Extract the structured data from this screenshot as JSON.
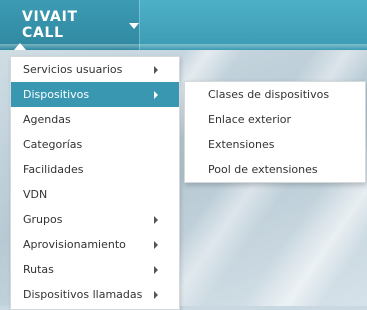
{
  "header": {
    "brand_label": "VIVAIT CALL",
    "brand_caret_icon": "caret-down-icon",
    "accent_color": "#3997b1"
  },
  "menu": {
    "items": [
      {
        "label": "Servicios usuarios",
        "has_submenu": true
      },
      {
        "label": "Dispositivos",
        "has_submenu": true,
        "active": true
      },
      {
        "label": "Agendas",
        "has_submenu": false
      },
      {
        "label": "Categorías",
        "has_submenu": false
      },
      {
        "label": "Facilidades",
        "has_submenu": false
      },
      {
        "label": "VDN",
        "has_submenu": false
      },
      {
        "label": "Grupos",
        "has_submenu": true
      },
      {
        "label": "Aprovisionamiento",
        "has_submenu": true
      },
      {
        "label": "Rutas",
        "has_submenu": true
      },
      {
        "label": "Dispositivos llamadas",
        "has_submenu": true
      }
    ]
  },
  "submenu": {
    "items": [
      {
        "label": "Clases de dispositivos"
      },
      {
        "label": "Enlace exterior"
      },
      {
        "label": "Extensiones"
      },
      {
        "label": "Pool de extensiones"
      }
    ]
  }
}
